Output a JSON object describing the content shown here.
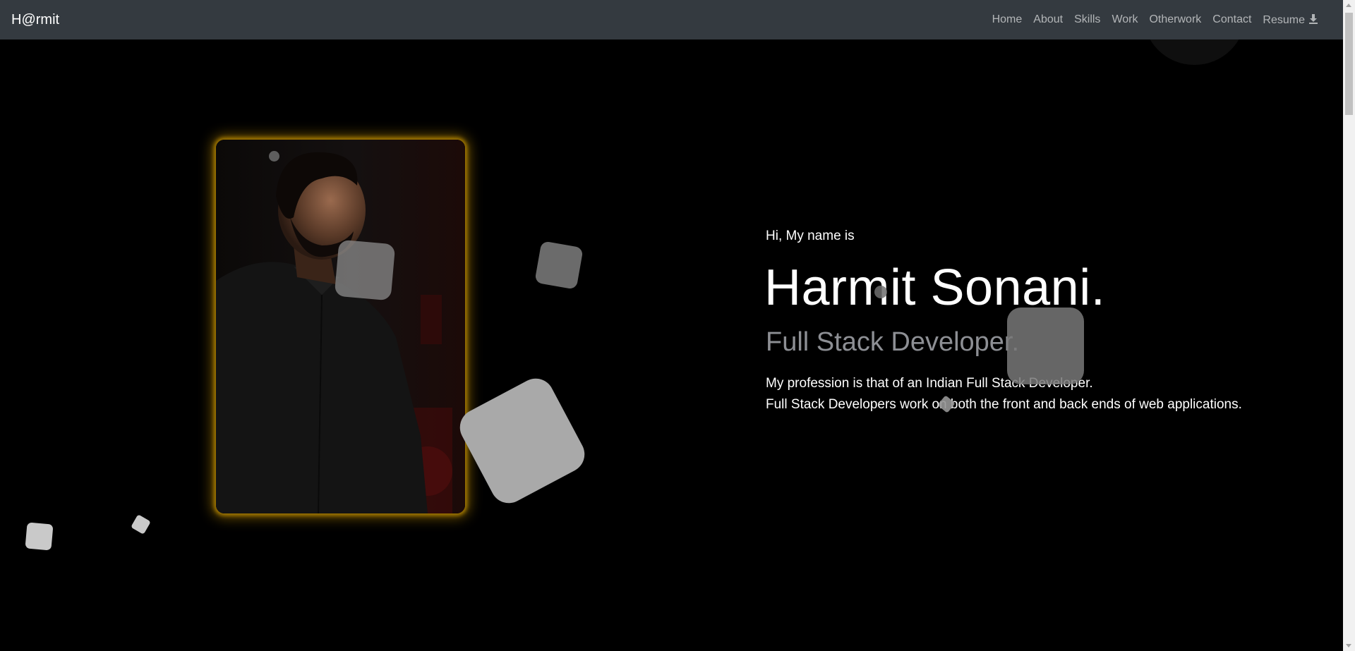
{
  "navbar": {
    "brand": "H@rmit",
    "links": [
      "Home",
      "About",
      "Skills",
      "Work",
      "Otherwork",
      "Contact",
      "Resume"
    ],
    "resume_icon": "download-icon"
  },
  "hero": {
    "greeting": "Hi, My name is",
    "name": "Harmit Sonani.",
    "role": "Full Stack Developer.",
    "description": [
      "My profession is that of an Indian Full Stack Developer.",
      "Full Stack Developers work on both the front and back ends of web applications."
    ],
    "photo_glow_color": "#b58400"
  },
  "colors": {
    "background": "#000000",
    "navbar": "#343a40",
    "nav_link": "rgba(255,255,255,0.62)",
    "role_text": "#8d8f94",
    "shape": "#c8c8c8"
  }
}
